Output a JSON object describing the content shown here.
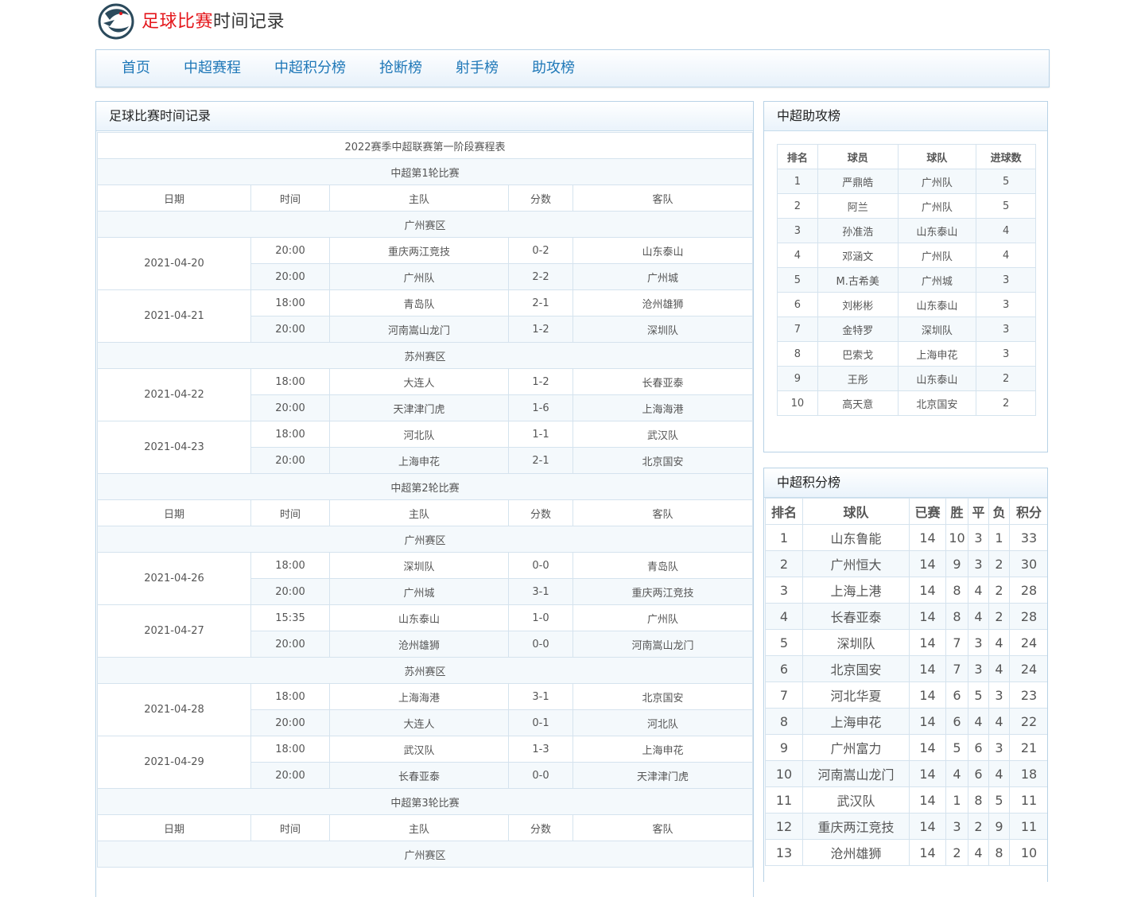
{
  "site": {
    "title_red": "足球比赛",
    "title_dark": "时间记录"
  },
  "nav": [
    "首页",
    "中超赛程",
    "中超积分榜",
    "抢断榜",
    "射手榜",
    "助攻榜"
  ],
  "schedule": {
    "panel_title": "足球比赛时间记录",
    "table_title": "2022赛季中超联赛第一阶段赛程表",
    "headers": [
      "日期",
      "时间",
      "主队",
      "分数",
      "客队"
    ],
    "rounds": [
      {
        "name": "中超第1轮比赛",
        "zones": [
          {
            "name": "广州赛区",
            "days": [
              {
                "date": "2021-04-20",
                "matches": [
                  {
                    "time": "20:00",
                    "home": "重庆两江竞技",
                    "score": "0-2",
                    "away": "山东泰山"
                  },
                  {
                    "time": "20:00",
                    "home": "广州队",
                    "score": "2-2",
                    "away": "广州城"
                  }
                ]
              },
              {
                "date": "2021-04-21",
                "matches": [
                  {
                    "time": "18:00",
                    "home": "青岛队",
                    "score": "2-1",
                    "away": "沧州雄狮"
                  },
                  {
                    "time": "20:00",
                    "home": "河南嵩山龙门",
                    "score": "1-2",
                    "away": "深圳队"
                  }
                ]
              }
            ]
          },
          {
            "name": "苏州赛区",
            "days": [
              {
                "date": "2021-04-22",
                "matches": [
                  {
                    "time": "18:00",
                    "home": "大连人",
                    "score": "1-2",
                    "away": "长春亚泰"
                  },
                  {
                    "time": "20:00",
                    "home": "天津津门虎",
                    "score": "1-6",
                    "away": "上海海港"
                  }
                ]
              },
              {
                "date": "2021-04-23",
                "matches": [
                  {
                    "time": "18:00",
                    "home": "河北队",
                    "score": "1-1",
                    "away": "武汉队"
                  },
                  {
                    "time": "20:00",
                    "home": "上海申花",
                    "score": "2-1",
                    "away": "北京国安"
                  }
                ]
              }
            ]
          }
        ]
      },
      {
        "name": "中超第2轮比赛",
        "zones": [
          {
            "name": "广州赛区",
            "days": [
              {
                "date": "2021-04-26",
                "matches": [
                  {
                    "time": "18:00",
                    "home": "深圳队",
                    "score": "0-0",
                    "away": "青岛队"
                  },
                  {
                    "time": "20:00",
                    "home": "广州城",
                    "score": "3-1",
                    "away": "重庆两江竞技"
                  }
                ]
              },
              {
                "date": "2021-04-27",
                "matches": [
                  {
                    "time": "15:35",
                    "home": "山东泰山",
                    "score": "1-0",
                    "away": "广州队"
                  },
                  {
                    "time": "20:00",
                    "home": "沧州雄狮",
                    "score": "0-0",
                    "away": "河南嵩山龙门"
                  }
                ]
              }
            ]
          },
          {
            "name": "苏州赛区",
            "days": [
              {
                "date": "2021-04-28",
                "matches": [
                  {
                    "time": "18:00",
                    "home": "上海海港",
                    "score": "3-1",
                    "away": "北京国安"
                  },
                  {
                    "time": "20:00",
                    "home": "大连人",
                    "score": "0-1",
                    "away": "河北队"
                  }
                ]
              },
              {
                "date": "2021-04-29",
                "matches": [
                  {
                    "time": "18:00",
                    "home": "武汉队",
                    "score": "1-3",
                    "away": "上海申花"
                  },
                  {
                    "time": "20:00",
                    "home": "长春亚泰",
                    "score": "0-0",
                    "away": "天津津门虎"
                  }
                ]
              }
            ]
          }
        ]
      },
      {
        "name": "中超第3轮比赛",
        "zones": [
          {
            "name": "广州赛区",
            "days": []
          }
        ]
      }
    ]
  },
  "assists": {
    "panel_title": "中超助攻榜",
    "headers": [
      "排名",
      "球员",
      "球队",
      "进球数"
    ],
    "rows": [
      [
        "1",
        "严鼎皓",
        "广州队",
        "5"
      ],
      [
        "2",
        "阿兰",
        "广州队",
        "5"
      ],
      [
        "3",
        "孙准浩",
        "山东泰山",
        "4"
      ],
      [
        "4",
        "邓涵文",
        "广州队",
        "4"
      ],
      [
        "5",
        "M.古希美",
        "广州城",
        "3"
      ],
      [
        "6",
        "刘彬彬",
        "山东泰山",
        "3"
      ],
      [
        "7",
        "金特罗",
        "深圳队",
        "3"
      ],
      [
        "8",
        "巴索戈",
        "上海申花",
        "3"
      ],
      [
        "9",
        "王彤",
        "山东泰山",
        "2"
      ],
      [
        "10",
        "高天意",
        "北京国安",
        "2"
      ]
    ]
  },
  "standings": {
    "panel_title": "中超积分榜",
    "headers": [
      "排名",
      "球队",
      "已赛",
      "胜",
      "平",
      "负",
      "积分"
    ],
    "rows": [
      [
        "1",
        "山东鲁能",
        "14",
        "10",
        "3",
        "1",
        "33"
      ],
      [
        "2",
        "广州恒大",
        "14",
        "9",
        "3",
        "2",
        "30"
      ],
      [
        "3",
        "上海上港",
        "14",
        "8",
        "4",
        "2",
        "28"
      ],
      [
        "4",
        "长春亚泰",
        "14",
        "8",
        "4",
        "2",
        "28"
      ],
      [
        "5",
        "深圳队",
        "14",
        "7",
        "3",
        "4",
        "24"
      ],
      [
        "6",
        "北京国安",
        "14",
        "7",
        "3",
        "4",
        "24"
      ],
      [
        "7",
        "河北华夏",
        "14",
        "6",
        "5",
        "3",
        "23"
      ],
      [
        "8",
        "上海申花",
        "14",
        "6",
        "4",
        "4",
        "22"
      ],
      [
        "9",
        "广州富力",
        "14",
        "5",
        "6",
        "3",
        "21"
      ],
      [
        "10",
        "河南嵩山龙门",
        "14",
        "4",
        "6",
        "4",
        "18"
      ],
      [
        "11",
        "武汉队",
        "14",
        "1",
        "8",
        "5",
        "11"
      ],
      [
        "12",
        "重庆两江竞技",
        "14",
        "3",
        "2",
        "9",
        "11"
      ],
      [
        "13",
        "沧州雄狮",
        "14",
        "2",
        "4",
        "8",
        "10"
      ]
    ]
  }
}
